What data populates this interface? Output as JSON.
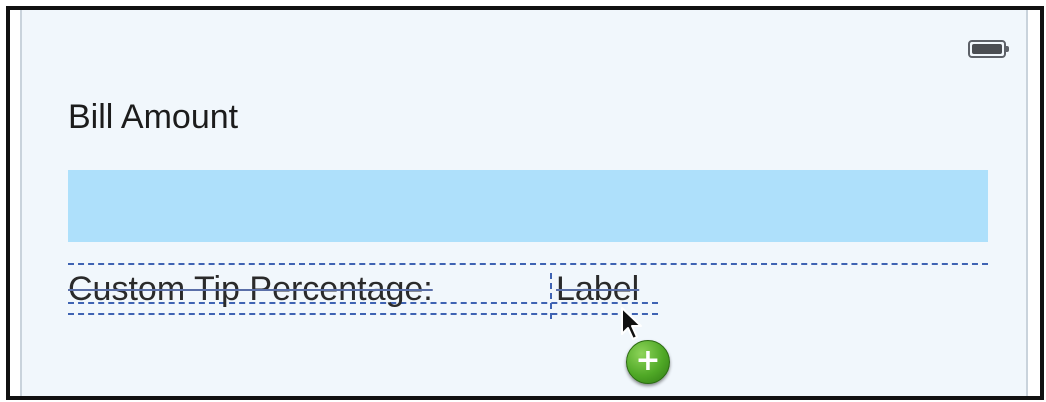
{
  "scene": {
    "bill_amount_label": "Bill Amount",
    "custom_tip_label": "Custom Tip Percentage:",
    "value_label": "Label",
    "add_badge_glyph": "+"
  },
  "icons": {
    "battery": "battery-icon",
    "cursor": "arrow-cursor-icon",
    "add": "plus-circle-icon"
  },
  "colors": {
    "canvas_background": "#f1f7fc",
    "text_field_highlight": "#aee0fb",
    "guide_lines": "#3f63b3",
    "add_badge": "#4fa826"
  }
}
